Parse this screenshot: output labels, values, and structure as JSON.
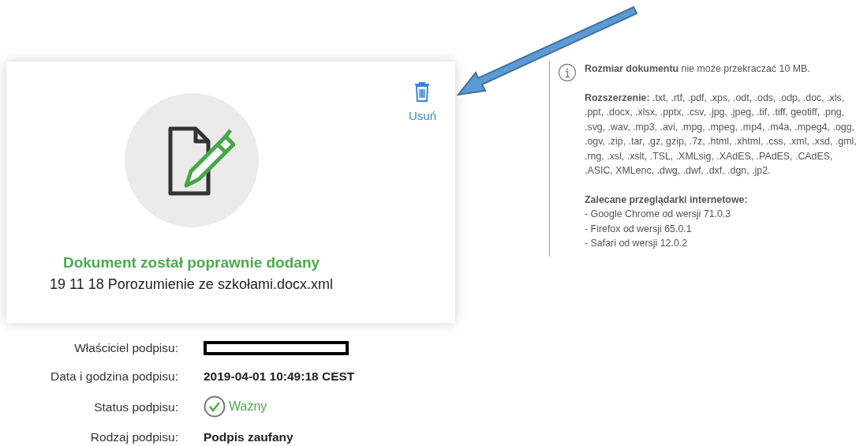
{
  "card": {
    "delete_label": "Usuń",
    "title": "Dokument został poprawnie dodany",
    "filename": "19 11 18 Porozumienie ze szkołami.docx.xml"
  },
  "details": [
    {
      "label": "Właściciel podpisu:",
      "kind": "redacted"
    },
    {
      "label": "Data i godzina podpisu:",
      "kind": "bold",
      "value": "2019-04-01 10:49:18 CEST"
    },
    {
      "label": "Status podpisu:",
      "kind": "status",
      "value": "Ważny"
    },
    {
      "label": "Rodzaj podpisu:",
      "kind": "bold",
      "value": "Podpis zaufany"
    }
  ],
  "info": {
    "size_note": "**Rozmiar dokumentu** nie może przekraczać 10 MB.",
    "extensions": "**Rozszerzenie:** .txt, .rtf, .pdf, .xps, .odt, .ods, .odp, .doc, .xls, .ppt, .docx, .xlsx, .pptx, .csv, .jpg, .jpeg, .tif, .tiff, geotiff, .png, .svg, .wav, .mp3, .avi, .mpg, .mpeg, .mp4, .m4a, .mpeg4, .ogg, .ogv, .zip, .tar, .gz, gzip, .7z, .html, .xhtml, .css, .xml, .xsd, .gml, .rng, .xsl, .xslt, .TSL, .XMLsig, .XAdES, .PAdES, .CAdES, .ASIC, XMLenc, .dwg, .dwf, .dxf, .dgn, .jp2.",
    "browsers_title": "Zalecane przeglądarki internetowe:",
    "browsers": [
      "- Google Chrome od wersji 71.0.3",
      "- Firefox od wersji 65.0.1",
      "- Safari od wersji 12.0.2"
    ]
  }
}
